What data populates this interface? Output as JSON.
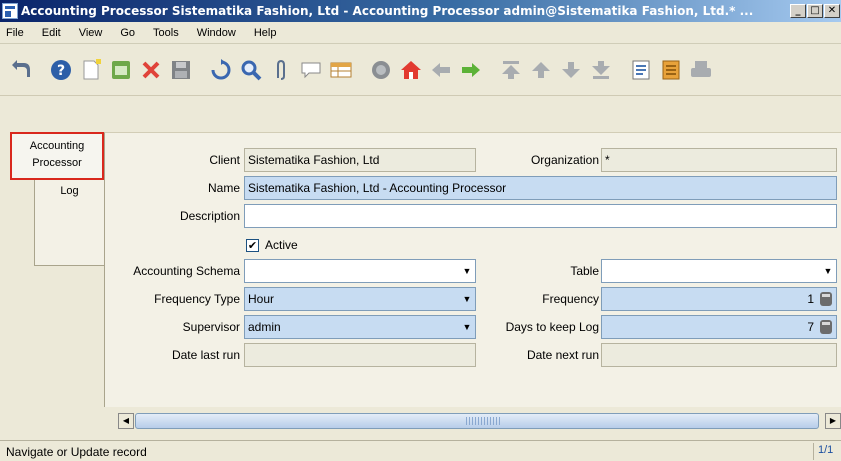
{
  "window": {
    "title": "Accounting Processor  Sistematika Fashion, Ltd - Accounting Processor  admin@Sistematika Fashion, Ltd.* ...",
    "buttons": [
      "_",
      "□",
      "✕"
    ]
  },
  "menu": [
    "File",
    "Edit",
    "View",
    "Go",
    "Tools",
    "Window",
    "Help"
  ],
  "toolbar": {
    "icons": [
      "undo-icon",
      "help-icon",
      "new-record-icon",
      "copy-record-icon",
      "delete-icon",
      "save-icon",
      "refresh-icon",
      "find-icon",
      "attachment-icon",
      "chat-icon",
      "grid-toggle-icon",
      "history-icon",
      "home-icon",
      "back-icon",
      "forward-icon",
      "first-record-icon",
      "previous-record-icon",
      "next-record-icon",
      "last-record-icon",
      "report-icon",
      "archive-icon",
      "print-icon"
    ]
  },
  "tabs": [
    "Accounting Processor",
    "Log"
  ],
  "form": {
    "client_label": "Client",
    "client_value": "Sistematika Fashion, Ltd",
    "organization_label": "Organization",
    "organization_value": "*",
    "name_label": "Name",
    "name_value": "Sistematika Fashion, Ltd - Accounting Processor",
    "description_label": "Description",
    "description_value": "",
    "active_label": "Active",
    "active_checked": true,
    "accounting_schema_label": "Accounting Schema",
    "accounting_schema_value": "",
    "table_label": "Table",
    "table_value": "",
    "frequency_type_label": "Frequency Type",
    "frequency_type_value": "Hour",
    "frequency_label": "Frequency",
    "frequency_value": "1",
    "supervisor_label": "Supervisor",
    "supervisor_value": "admin",
    "days_to_keep_log_label": "Days to keep Log",
    "days_to_keep_log_value": "7",
    "date_last_run_label": "Date last run",
    "date_last_run_value": "",
    "date_next_run_label": "Date next run",
    "date_next_run_value": ""
  },
  "status": {
    "text": "Navigate or Update record",
    "record": "1/1"
  }
}
